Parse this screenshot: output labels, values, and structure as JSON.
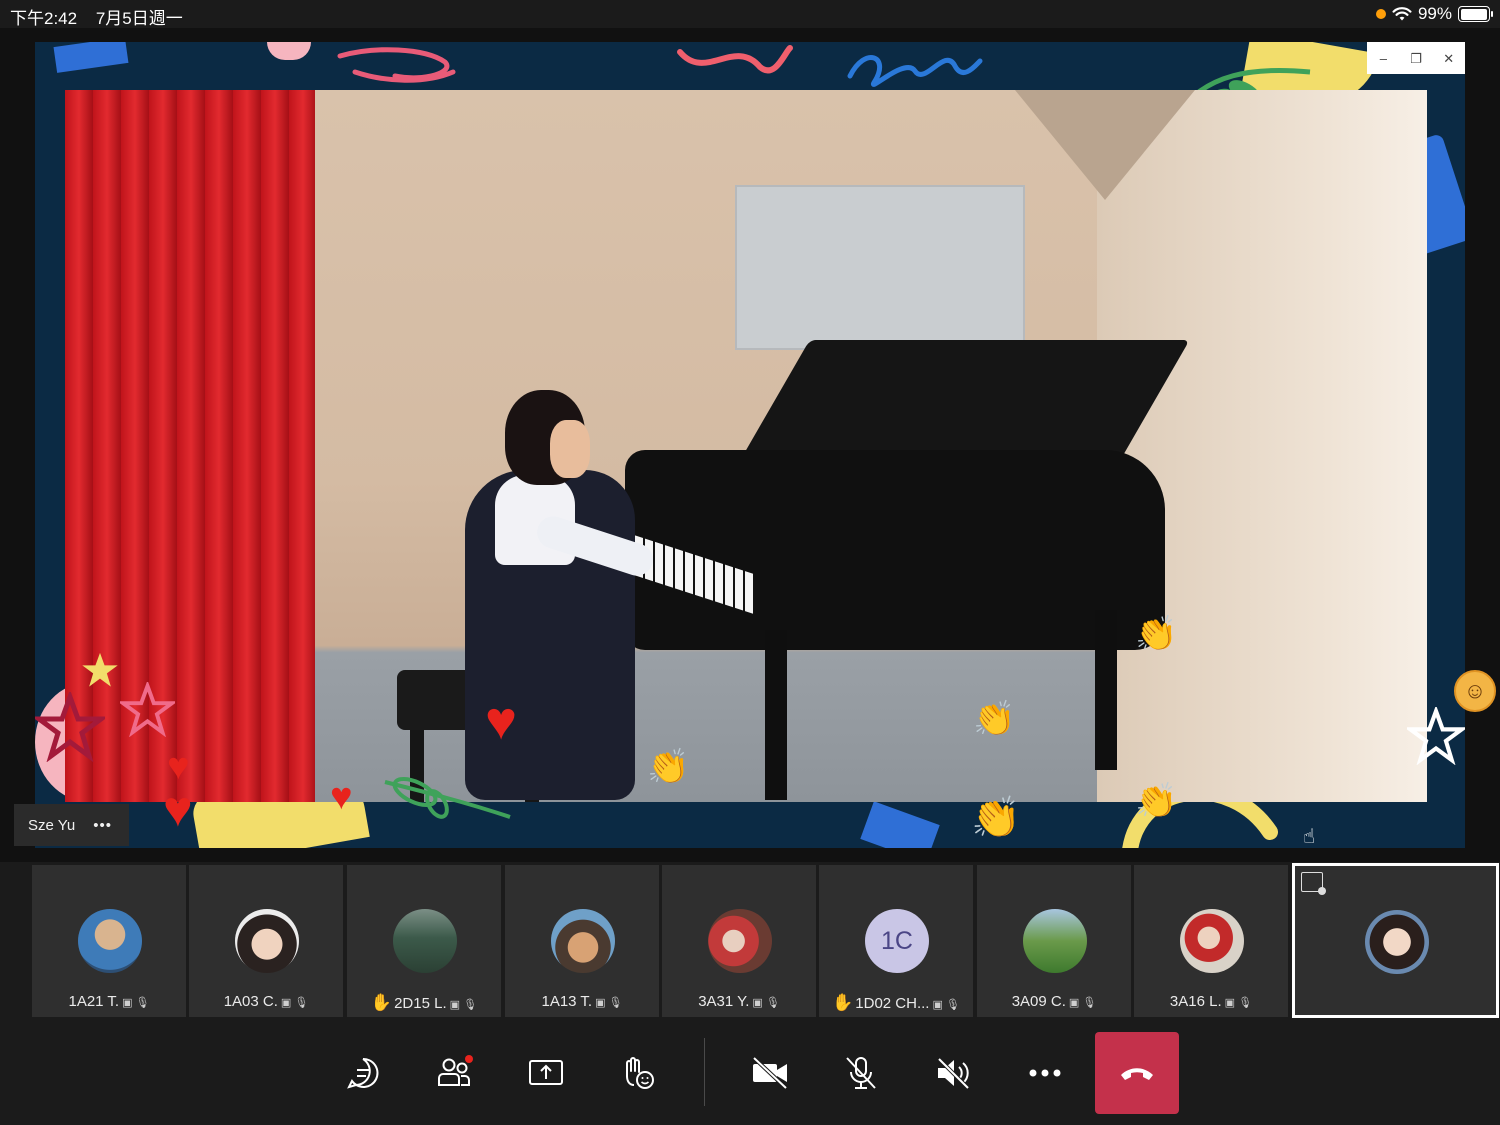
{
  "status_bar": {
    "time": "下午2:42",
    "date": "7月5日週一",
    "battery_text": "99%",
    "battery_level": 0.99
  },
  "presenter": {
    "name": "Sze Yu",
    "more_label": "•••"
  },
  "window_controls": [
    "–",
    "❐",
    "✕"
  ],
  "participants": [
    {
      "name": "1A21 T.",
      "hand_raised": false
    },
    {
      "name": "1A03 C.",
      "hand_raised": false
    },
    {
      "name": "2D15 L.",
      "hand_raised": true
    },
    {
      "name": "1A13 T.",
      "hand_raised": false
    },
    {
      "name": "3A31 Y.",
      "hand_raised": false
    },
    {
      "name": "1D02 CH...",
      "hand_raised": true,
      "initials": "1C"
    },
    {
      "name": "3A09 C.",
      "hand_raised": false
    },
    {
      "name": "3A16 L.",
      "hand_raised": false
    }
  ],
  "participant_mini_icons": "▣ 🎙",
  "hand_glyph": "✋",
  "colors": {
    "accent_hangup": "#c4314b",
    "frame_navy": "#0b2a44",
    "initials_bg": "#c9c6e6",
    "notification_dot": "#e8231d"
  },
  "controls": [
    {
      "icon": "chat-icon"
    },
    {
      "icon": "participants-icon",
      "badge": true
    },
    {
      "icon": "share-screen-icon"
    },
    {
      "icon": "reactions-icon"
    },
    {
      "icon": "camera-off-icon"
    },
    {
      "icon": "mic-off-icon"
    },
    {
      "icon": "speaker-off-icon"
    },
    {
      "icon": "more-icon"
    },
    {
      "icon": "hang-up-icon"
    }
  ]
}
